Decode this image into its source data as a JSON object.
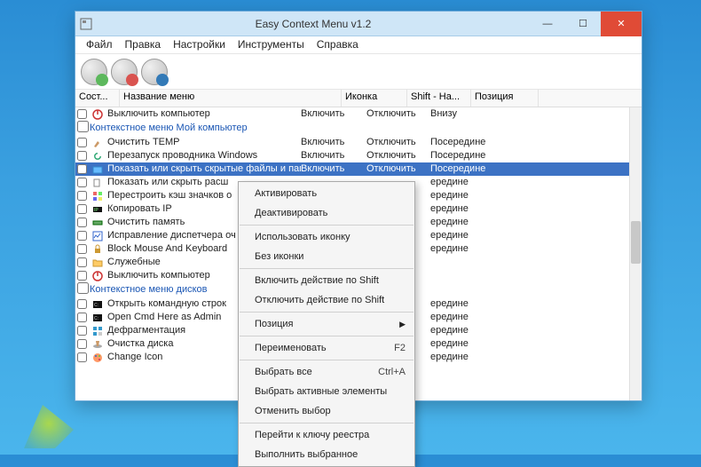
{
  "window": {
    "title": "Easy Context Menu v1.2"
  },
  "menu": {
    "file": "Файл",
    "edit": "Правка",
    "settings": "Настройки",
    "tools": "Инструменты",
    "help": "Справка"
  },
  "cols": {
    "state": "Сост...",
    "name": "Название меню",
    "icon": "Иконка",
    "shift": "Shift - На...",
    "pos": "Позиция"
  },
  "vals": {
    "enable": "Включить",
    "disable": "Отключить",
    "middle": "Посередине",
    "middle_cut": "ередине",
    "bottom": "Внизу"
  },
  "group1": "Контекстное меню Мой компьютер",
  "group2": "Контекстное меню дисков",
  "rows": {
    "r0": "Выключить компьютер",
    "r1": "Очистить TEMP",
    "r2": "Перезапуск проводника Windows",
    "r3": "Показать или скрыть скрытые файлы и папки",
    "r4": "Показать или скрыть расш",
    "r5": "Перестроить кэш значков о",
    "r6": "Копировать IP",
    "r7": "Очистить память",
    "r8": "Исправление диспетчера оч",
    "r9": "Block Mouse And Keyboard",
    "r10": "Служебные",
    "r11": "Выключить компьютер",
    "r12": "Открыть командную строк",
    "r13": "Open Cmd Here as Admin",
    "r14": "Дефрагментация",
    "r15": "Очистка диска",
    "r16": "Change Icon"
  },
  "ctx": {
    "activate": "Активировать",
    "deactivate": "Деактивировать",
    "useicon": "Использовать иконку",
    "noicon": "Без иконки",
    "shifton": "Включить действие по Shift",
    "shiftoff": "Отключить действие по Shift",
    "position": "Позиция",
    "rename": "Переименовать",
    "rename_sc": "F2",
    "selall": "Выбрать все",
    "selall_sc": "Ctrl+A",
    "selactive": "Выбрать активные элементы",
    "desel": "Отменить выбор",
    "regkey": "Перейти к ключу реестра",
    "runsel": "Выполнить выбранное"
  }
}
